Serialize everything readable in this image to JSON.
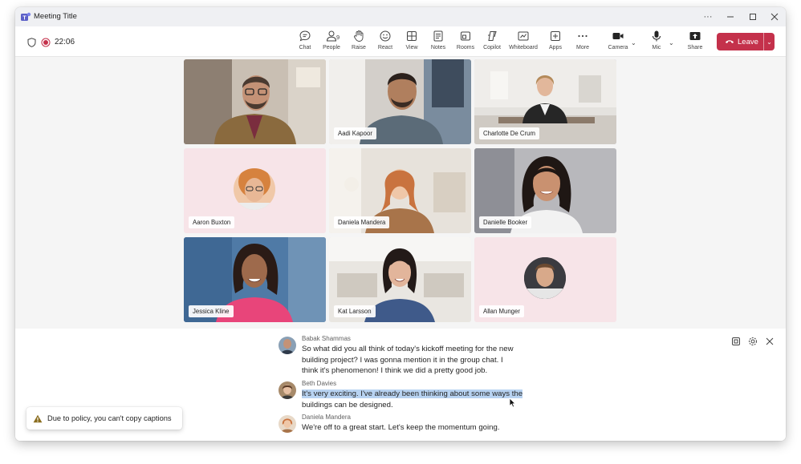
{
  "window": {
    "title": "Meeting Title",
    "controls": [
      "more",
      "minimize",
      "maximize",
      "close"
    ]
  },
  "toolbar": {
    "timer": "22:06",
    "people_count": "9",
    "tools": [
      {
        "label": "Chat",
        "icon": "chat-icon"
      },
      {
        "label": "People",
        "icon": "people-icon"
      },
      {
        "label": "Raise",
        "icon": "raise-hand-icon"
      },
      {
        "label": "React",
        "icon": "react-icon"
      },
      {
        "label": "View",
        "icon": "view-icon"
      },
      {
        "label": "Notes",
        "icon": "notes-icon"
      },
      {
        "label": "Rooms",
        "icon": "rooms-icon"
      },
      {
        "label": "Copilot",
        "icon": "copilot-icon"
      },
      {
        "label": "Whiteboard",
        "icon": "whiteboard-icon"
      },
      {
        "label": "Apps",
        "icon": "apps-icon"
      },
      {
        "label": "More",
        "icon": "more-icon"
      },
      {
        "label": "Camera",
        "icon": "camera-icon"
      },
      {
        "label": "Mic",
        "icon": "mic-icon"
      },
      {
        "label": "Share",
        "icon": "share-icon"
      }
    ],
    "leave_label": "Leave",
    "leave_color": "#c4314b"
  },
  "participants": [
    {
      "name": "",
      "type": "video"
    },
    {
      "name": "Aadi Kapoor",
      "type": "video"
    },
    {
      "name": "Charlotte De Crum",
      "type": "video",
      "active_speaker": true
    },
    {
      "name": "Aaron Buxton",
      "type": "avatar"
    },
    {
      "name": "Daniela Mandera",
      "type": "video"
    },
    {
      "name": "Danielle Booker",
      "type": "video"
    },
    {
      "name": "Jessica Kline",
      "type": "video"
    },
    {
      "name": "Kat Larsson",
      "type": "video"
    },
    {
      "name": "Allan Munger",
      "type": "avatar"
    }
  ],
  "captions": [
    {
      "speaker": "Babak Shammas",
      "lines": [
        "So what did you all think of today's kickoff meeting for the new",
        "building project? I was gonna mention it in the group chat. I",
        "think it's phenomenon! I think we did a pretty good job."
      ]
    },
    {
      "speaker": "Beth Davies",
      "highlighted": "It's very exciting. I've already been thinking about some ways the",
      "rest": "buildings can be designed."
    },
    {
      "speaker": "Daniela Mandera",
      "lines": [
        "We're off to a great start. Let's keep the momentum going."
      ]
    }
  ],
  "toast": {
    "message": "Due to policy, you can't copy captions",
    "icon": "warning-icon"
  },
  "colors": {
    "accent": "#6264a7",
    "leave": "#c4314b",
    "highlight": "#b8d3f2"
  }
}
